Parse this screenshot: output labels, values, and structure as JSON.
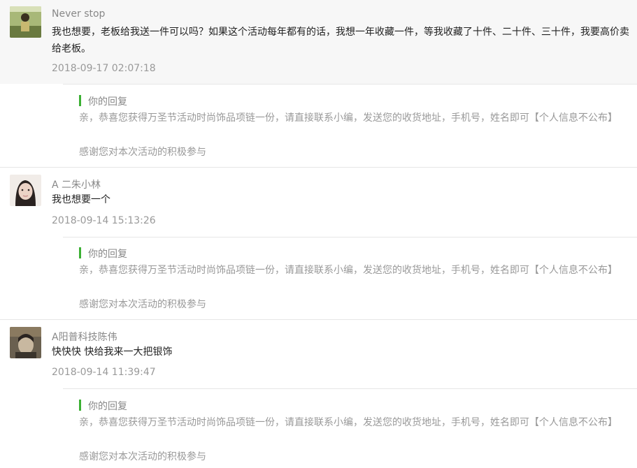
{
  "comments": [
    {
      "username": "Never stop",
      "content": "我也想要，老板给我送一件可以吗？如果这个活动每年都有的话，我想一年收藏一件，等我收藏了十件、二十件、三十件，我要高价卖给老板。",
      "timestamp": "2018-09-17 02:07:18",
      "avatar_colors": [
        "#7a8a50",
        "#5a6a38",
        "#c8b870"
      ],
      "reply": {
        "label": "你的回复",
        "text": "亲，恭喜您获得万圣节活动时尚饰品项链一份，请直接联系小编，发送您的收货地址，手机号，姓名即可【个人信息不公布】",
        "thanks": "感谢您对本次活动的积极参与"
      }
    },
    {
      "username": "A 二朱小林",
      "content": "我也想要一个",
      "timestamp": "2018-09-14 15:13:26",
      "avatar_colors": [
        "#f1ece8",
        "#2a2220",
        "#e8cfc2"
      ],
      "reply": {
        "label": "你的回复",
        "text": "亲，恭喜您获得万圣节活动时尚饰品项链一份，请直接联系小编，发送您的收货地址，手机号，姓名即可【个人信息不公布】",
        "thanks": "感谢您对本次活动的积极参与"
      }
    },
    {
      "username": "A阳普科技陈伟",
      "content": "快快快 快给我来一大把银饰",
      "timestamp": "2018-09-14 11:39:47",
      "avatar_colors": [
        "#4a4438",
        "#8a7a60",
        "#c8b8a0"
      ],
      "reply": {
        "label": "你的回复",
        "text": "亲，恭喜您获得万圣节活动时尚饰品项链一份，请直接联系小编，发送您的收货地址，手机号，姓名即可【个人信息不公布】",
        "thanks": "感谢您对本次活动的积极参与"
      }
    }
  ],
  "colors": {
    "accent_green": "#3cb034",
    "highlight_bg": "#f7f7f7",
    "text_primary": "#222222",
    "text_muted": "#999999"
  }
}
